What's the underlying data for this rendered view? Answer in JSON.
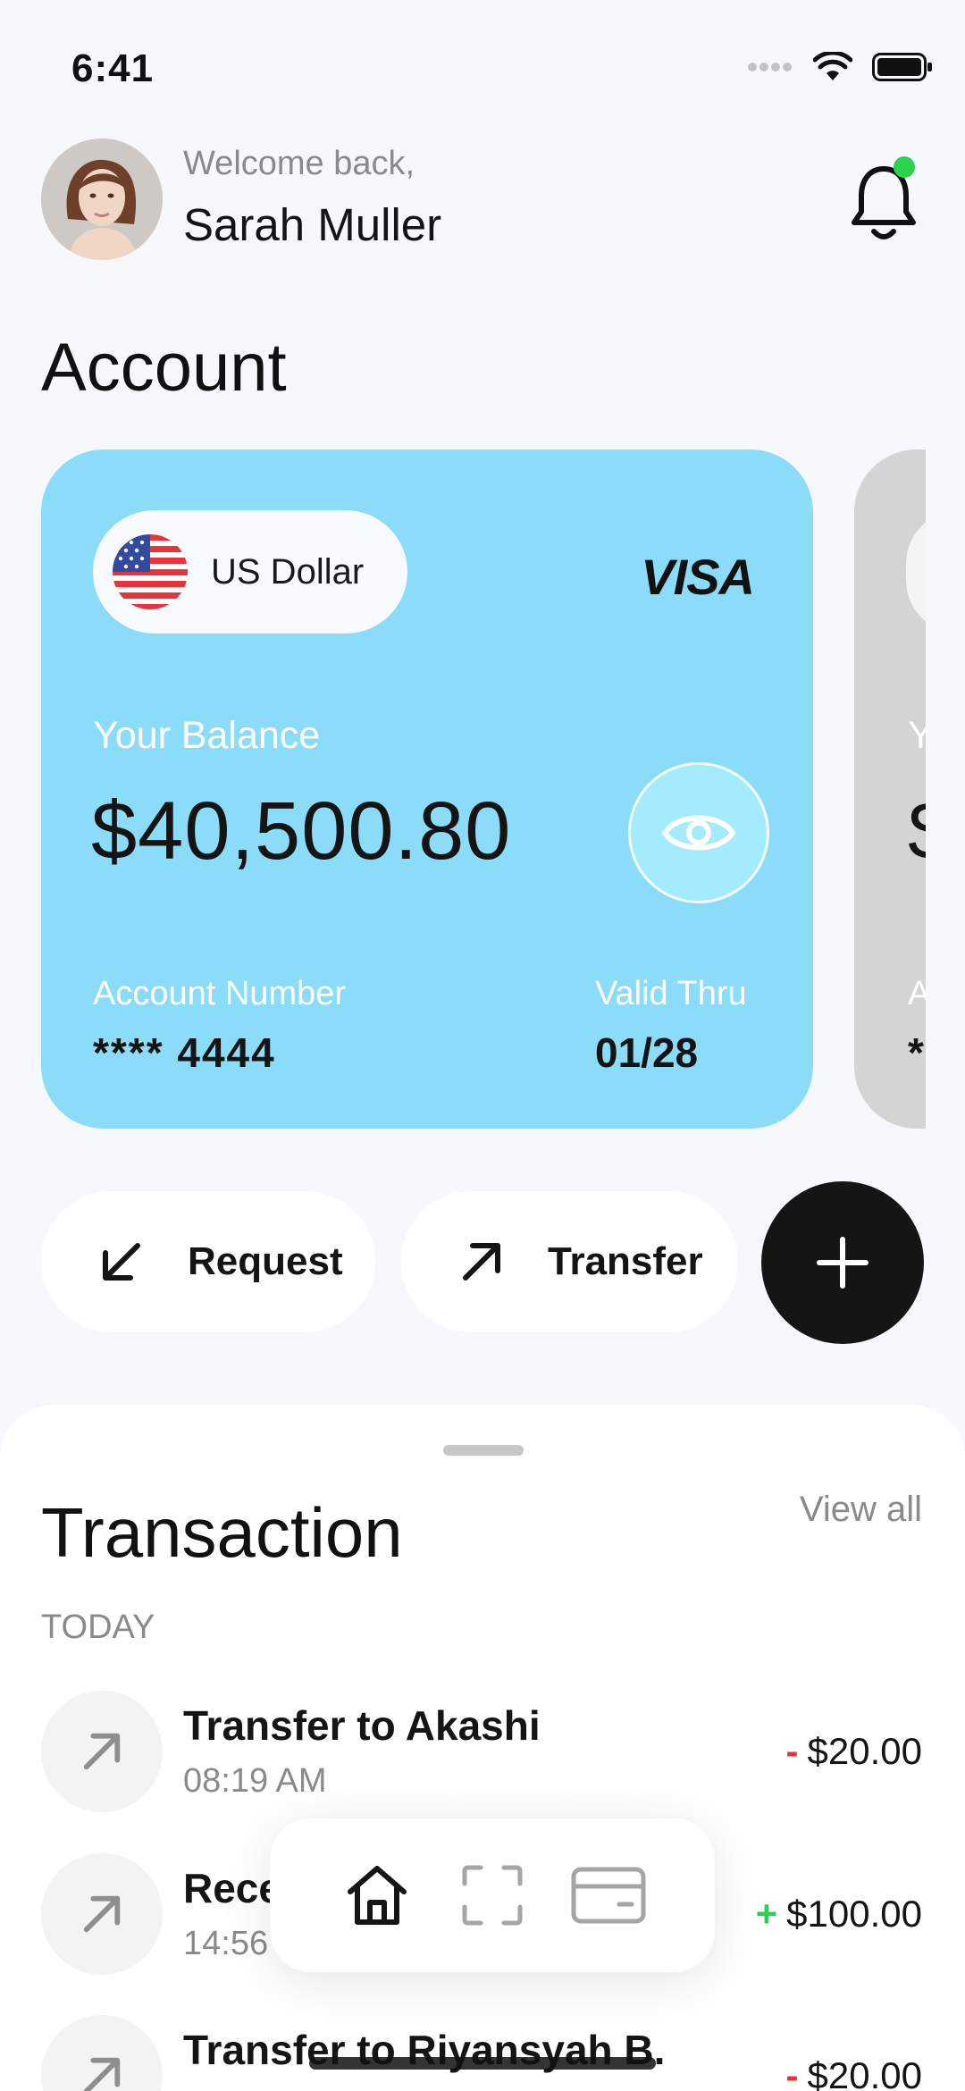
{
  "status_bar": {
    "time": "6:41"
  },
  "header": {
    "welcome": "Welcome back,",
    "name": "Sarah Muller"
  },
  "section_title": "Account",
  "card": {
    "currency": "US Dollar",
    "brand": "VISA",
    "balance_label": "Your Balance",
    "balance": "$40,500.80",
    "account_number_label": "Account Number",
    "account_number": "**** 4444",
    "valid_thru_label": "Valid Thru",
    "valid_thru": "01/28",
    "color": "#8bdcf8"
  },
  "card2_peek": {
    "label_initial": "Y",
    "balance_initial": "$",
    "acc_initial": "A",
    "num_initial": "*"
  },
  "actions": {
    "request": "Request",
    "transfer": "Transfer"
  },
  "transactions": {
    "title": "Transaction",
    "view_all": "View all",
    "group": "TODAY",
    "items": [
      {
        "name": "Transfer to Akashi",
        "time": "08:19 AM",
        "sign": "-",
        "amount": "$20.00",
        "icon": "arrow-up-right-icon"
      },
      {
        "name": "Rece",
        "time": "14:56",
        "sign": "+",
        "amount": "$100.00",
        "icon": "arrow-up-right-icon"
      },
      {
        "name": "Transfer to Riyansyah B.",
        "time": "",
        "sign": "-",
        "amount": "$20.00",
        "icon": "arrow-up-right-icon"
      }
    ]
  },
  "tabbar": {
    "tabs": [
      "home-icon",
      "scan-icon",
      "card-icon"
    ],
    "active": "home-icon"
  },
  "colors": {
    "accent_green": "#2bd24f",
    "negative_red": "#e8323c",
    "card_blue": "#8bdcf8"
  }
}
